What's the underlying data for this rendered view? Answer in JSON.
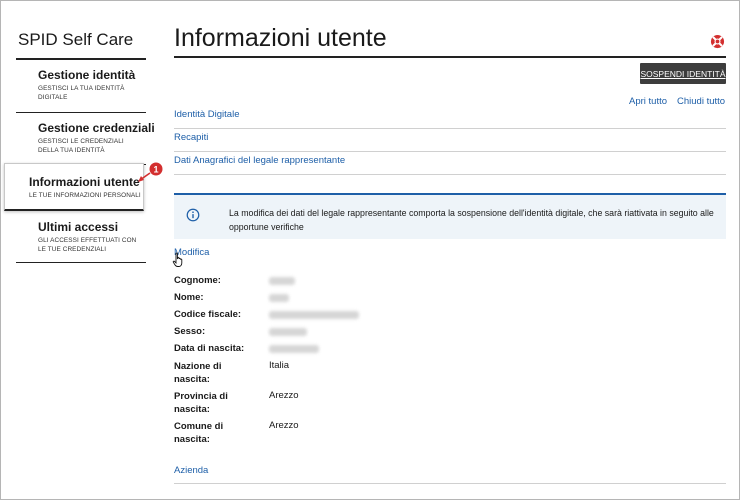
{
  "sidebar": {
    "brand": "SPID Self Care",
    "items": [
      {
        "label": "Gestione identità",
        "sub": "GESTISCI LA TUA IDENTITÀ DIGITALE"
      },
      {
        "label": "Gestione credenziali",
        "sub": "GESTISCI LE CREDENZIALI DELLA TUA IDENTITÀ"
      },
      {
        "label": "Informazioni utente",
        "sub": "LE TUE INFORMAZIONI PERSONALI"
      },
      {
        "label": "Ultimi accessi",
        "sub": "GLI ACCESSI EFFETTUATI CON LE TUE CREDENZIALI"
      }
    ],
    "marker_number": "1"
  },
  "main": {
    "title": "Informazioni utente",
    "suspend_button": "SOSPENDI IDENTITÀ",
    "open_all": "Apri tutto",
    "close_all": "Chiudi tutto",
    "sections": [
      "Identità Digitale",
      "Recapiti",
      "Dati Anagrafici del legale rappresentante"
    ],
    "info_message": "La modifica dei dati del legale rappresentante comporta la sospensione dell'identità digitale, che sarà riattivata in seguito alle opportune verifiche",
    "edit_link": "Modifica",
    "fields": [
      {
        "label": "Cognome:",
        "value": ""
      },
      {
        "label": "Nome:",
        "value": ""
      },
      {
        "label": "Codice fiscale:",
        "value": ""
      },
      {
        "label": "Sesso:",
        "value": ""
      },
      {
        "label": "Data di nascita:",
        "value": ""
      },
      {
        "label": "Nazione di nascita:",
        "value": "Italia"
      },
      {
        "label": "Provincia di nascita:",
        "value": "Arezzo"
      },
      {
        "label": "Comune di nascita:",
        "value": "Arezzo"
      }
    ],
    "bottom_section": "Azienda"
  },
  "colors": {
    "link": "#1e5fa8",
    "button_bg": "#3d3d3d",
    "info_bg": "#eef4f9",
    "marker": "#d32f2f"
  },
  "icons": {
    "help": "lifebuoy-icon",
    "info": "info-icon",
    "cursor": "hand-pointer-icon"
  }
}
